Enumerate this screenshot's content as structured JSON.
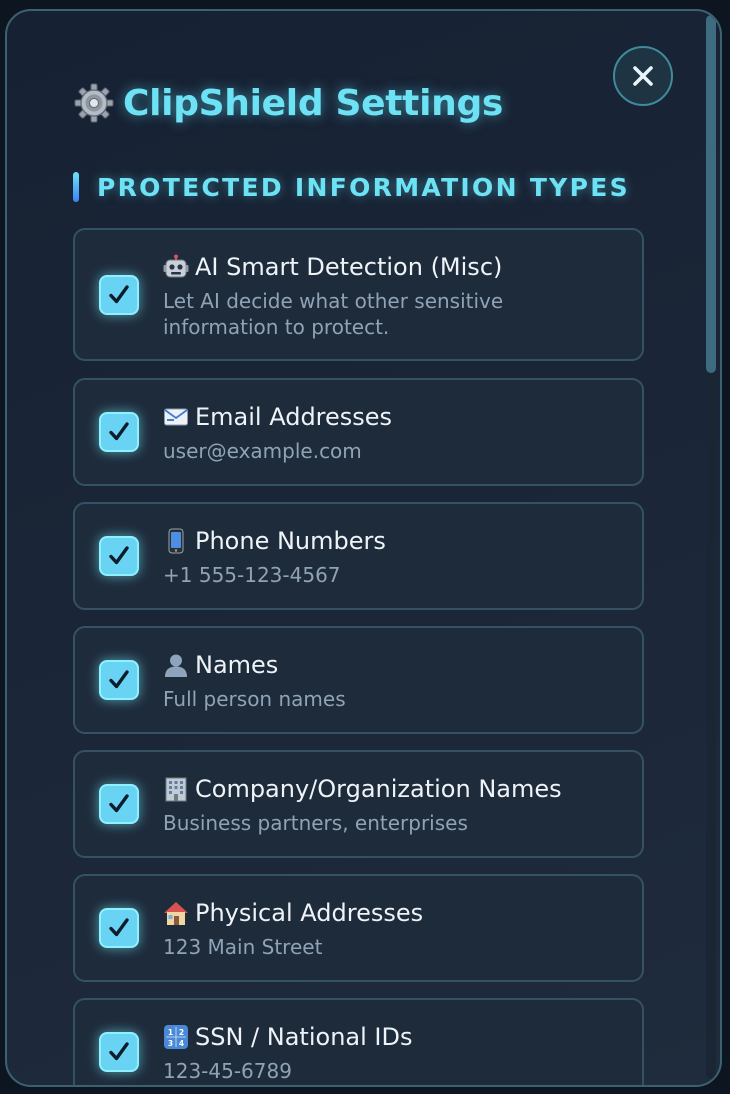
{
  "header": {
    "title": "ClipShield Settings",
    "close_icon": "close-icon",
    "title_icon": "gear-icon"
  },
  "section": {
    "title": "PROTECTED INFORMATION TYPES"
  },
  "options": [
    {
      "icon": "robot-icon",
      "label": "AI Smart Detection (Misc)",
      "description": "Let AI decide what other sensitive information to protect.",
      "checked": true
    },
    {
      "icon": "email-icon",
      "label": "Email Addresses",
      "description": "user@example.com",
      "checked": true
    },
    {
      "icon": "mobile-phone-icon",
      "label": "Phone Numbers",
      "description": "+1 555-123-4567",
      "checked": true
    },
    {
      "icon": "person-icon",
      "label": "Names",
      "description": "Full person names",
      "checked": true
    },
    {
      "icon": "office-building-icon",
      "label": "Company/Organization Names",
      "description": "Business partners, enterprises",
      "checked": true
    },
    {
      "icon": "house-icon",
      "label": "Physical Addresses",
      "description": "123 Main Street",
      "checked": true
    },
    {
      "icon": "numbers-icon",
      "label": "SSN / National IDs",
      "description": "123-45-6789",
      "checked": true
    }
  ],
  "colors": {
    "accent": "#6ee2f5",
    "checkbox": "#69d3f4",
    "card_bg": "#1e2b3b",
    "panel_bg": "#1b2638"
  }
}
